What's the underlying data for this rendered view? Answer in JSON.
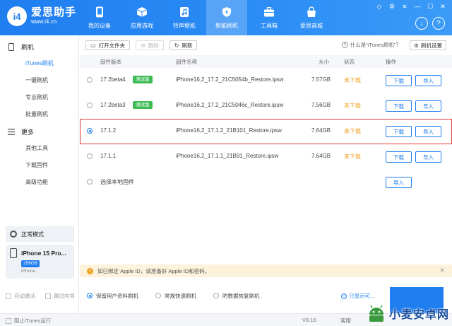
{
  "header": {
    "logo_mark": "i4",
    "app_name": "爱思助手",
    "app_url": "www.i4.cn",
    "nav": [
      {
        "label": "我的设备",
        "icon": "phone-icon"
      },
      {
        "label": "应用游戏",
        "icon": "cube-icon"
      },
      {
        "label": "铃声壁纸",
        "icon": "music-icon"
      },
      {
        "label": "智能刷机",
        "icon": "flash-icon"
      },
      {
        "label": "工具箱",
        "icon": "toolbox-icon"
      },
      {
        "label": "爱思商城",
        "icon": "shop-icon"
      }
    ],
    "active_nav": "智能刷机"
  },
  "sidebar": {
    "sections": [
      {
        "label": "刷机",
        "icon": "phone-outline-icon",
        "items": [
          "iTunes刷机",
          "一键刷机",
          "专业刷机",
          "批量刷机"
        ]
      },
      {
        "label": "更多",
        "icon": "menu-icon",
        "items": [
          "其他工具",
          "下载固件",
          "高级功能"
        ]
      }
    ],
    "active_item": "iTunes刷机",
    "mode_label": "正常模式",
    "device": {
      "name": "iPhone 15 Pro...",
      "capacity": "256GB",
      "type": "iPhone"
    },
    "checks": [
      {
        "label": "自动激活"
      },
      {
        "label": "跳过向导"
      }
    ]
  },
  "toolbar": {
    "open_folder": "打开文件夹",
    "delete": "删除",
    "refresh": "刷新",
    "help": "什么是“iTunes刷机”？",
    "settings": "刷机设置"
  },
  "table": {
    "columns": {
      "version": "固件版本",
      "name": "固件名称",
      "size": "大小",
      "status": "状态",
      "action": "操作"
    },
    "rows": [
      {
        "version": "17.2beta4",
        "badge": "测试版",
        "name": "iPhone16,2_17.2_21C5054b_Restore.ipsw",
        "size": "7.57GB",
        "status": "未下载",
        "download": "下载",
        "import": "导入",
        "selected": false
      },
      {
        "version": "17.2beta3",
        "badge": "测试版",
        "name": "iPhone16,2_17.2_21C5046c_Restore.ipsw",
        "size": "7.56GB",
        "status": "未下载",
        "download": "下载",
        "import": "导入",
        "selected": false
      },
      {
        "version": "17.1.2",
        "badge": "",
        "name": "iPhone16,2_17.1.2_21B101_Restore.ipsw",
        "size": "7.64GB",
        "status": "未下载",
        "download": "下载",
        "import": "导入",
        "selected": true
      },
      {
        "version": "17.1.1",
        "badge": "",
        "name": "iPhone16,2_17.1.1_21B91_Restore.ipsw",
        "size": "7.64GB",
        "status": "未下载",
        "download": "下载",
        "import": "导入",
        "selected": false
      }
    ],
    "local_label": "选择本地固件",
    "local_import": "导入"
  },
  "notice": {
    "text": "如已绑定 Apple ID，请准备好 Apple ID和密码。"
  },
  "options": {
    "items": [
      {
        "label": "保留用户资料刷机",
        "selected": true
      },
      {
        "label": "常规快速刷机",
        "selected": false
      },
      {
        "label": "防数据恢复刷机",
        "selected": false
      }
    ],
    "link": "只显示可..."
  },
  "statusbar": {
    "itunes": "阻止iTunes运行",
    "version": "V8.16",
    "service": "客服"
  },
  "watermark": {
    "text": "小麦安卓网"
  },
  "colors": {
    "accent": "#1f7ef0",
    "badge": "#3dbb55",
    "status": "#f0a020",
    "selection": "#e23b3b"
  }
}
